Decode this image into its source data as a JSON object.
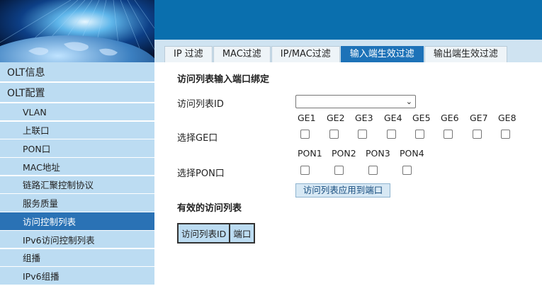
{
  "tabs": [
    {
      "label": "IP 过滤",
      "active": false
    },
    {
      "label": "MAC过滤",
      "active": false
    },
    {
      "label": "IP/MAC过滤",
      "active": false
    },
    {
      "label": "输入端生效过滤",
      "active": true
    },
    {
      "label": "输出端生效过滤",
      "active": false
    }
  ],
  "sidebar": {
    "top_items": [
      "OLT信息",
      "OLT配置"
    ],
    "sub_items": [
      {
        "label": "VLAN",
        "active": false
      },
      {
        "label": "上联口",
        "active": false
      },
      {
        "label": "PON口",
        "active": false
      },
      {
        "label": "MAC地址",
        "active": false
      },
      {
        "label": "链路汇聚控制协议",
        "active": false
      },
      {
        "label": "服务质量",
        "active": false
      },
      {
        "label": "访问控制列表",
        "active": true
      },
      {
        "label": "IPv6访问控制列表",
        "active": false
      },
      {
        "label": "组播",
        "active": false
      },
      {
        "label": "IPv6组播",
        "active": false
      }
    ]
  },
  "form": {
    "section_title": "访问列表输入端口绑定",
    "acl_id_label": "访问列表ID",
    "acl_id_value": "",
    "ge_label": "选择GE口",
    "ge_ports": [
      "GE1",
      "GE2",
      "GE3",
      "GE4",
      "GE5",
      "GE6",
      "GE7",
      "GE8"
    ],
    "pon_label": "选择PON口",
    "pon_ports": [
      "PON1",
      "PON2",
      "PON3",
      "PON4"
    ],
    "apply_button": "访问列表应用到端口"
  },
  "effective": {
    "title": "有效的访问列表",
    "columns": [
      "访问列表ID",
      "端口"
    ]
  },
  "colors": {
    "header_blue": "#0a6fae",
    "tab_active": "#1d72b8",
    "sidebar_bg": "#bcdcf2",
    "sidebar_active": "#2a72b5"
  }
}
